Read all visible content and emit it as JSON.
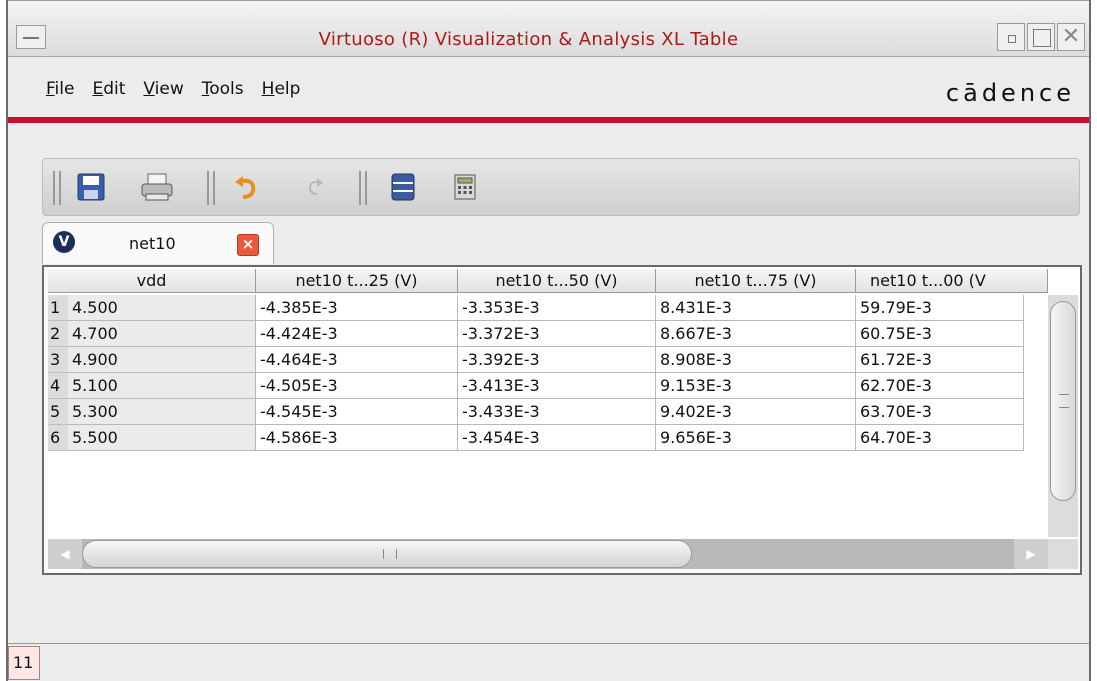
{
  "window": {
    "title": "Virtuoso (R) Visualization & Analysis XL Table"
  },
  "menu": {
    "items": [
      {
        "label": "File",
        "mnemonic": "F",
        "rest": "ile"
      },
      {
        "label": "Edit",
        "mnemonic": "E",
        "rest": "dit"
      },
      {
        "label": "View",
        "mnemonic": "V",
        "rest": "iew"
      },
      {
        "label": "Tools",
        "mnemonic": "T",
        "rest": "ools"
      },
      {
        "label": "Help",
        "mnemonic": "H",
        "rest": "elp"
      }
    ],
    "brand": "cādence"
  },
  "toolbar": {
    "icons": [
      "save-icon",
      "print-icon",
      "undo-icon",
      "redo-icon",
      "table-icon",
      "calculator-icon"
    ]
  },
  "tab": {
    "label": "net10"
  },
  "table": {
    "headers": [
      "vdd",
      "net10 t...25   (V)",
      "net10 t...50   (V)",
      "net10 t...75   (V)",
      "net10 t...00   (V"
    ],
    "rows": [
      {
        "num": "1",
        "cells": [
          "4.500",
          "-4.385E-3",
          "-3.353E-3",
          "8.431E-3",
          "59.79E-3"
        ]
      },
      {
        "num": "2",
        "cells": [
          "4.700",
          "-4.424E-3",
          "-3.372E-3",
          "8.667E-3",
          "60.75E-3"
        ]
      },
      {
        "num": "3",
        "cells": [
          "4.900",
          "-4.464E-3",
          "-3.392E-3",
          "8.908E-3",
          "61.72E-3"
        ]
      },
      {
        "num": "4",
        "cells": [
          "5.100",
          "-4.505E-3",
          "-3.413E-3",
          "9.153E-3",
          "62.70E-3"
        ]
      },
      {
        "num": "5",
        "cells": [
          "5.300",
          "-4.545E-3",
          "-3.433E-3",
          "9.402E-3",
          "63.70E-3"
        ]
      },
      {
        "num": "6",
        "cells": [
          "5.500",
          "-4.586E-3",
          "-3.454E-3",
          "9.656E-3",
          "64.70E-3"
        ]
      }
    ]
  },
  "status": {
    "count": "11"
  },
  "colors": {
    "title_text": "#b01818",
    "accent_line": "#c8102e",
    "tab_close": "#e85c3c"
  }
}
